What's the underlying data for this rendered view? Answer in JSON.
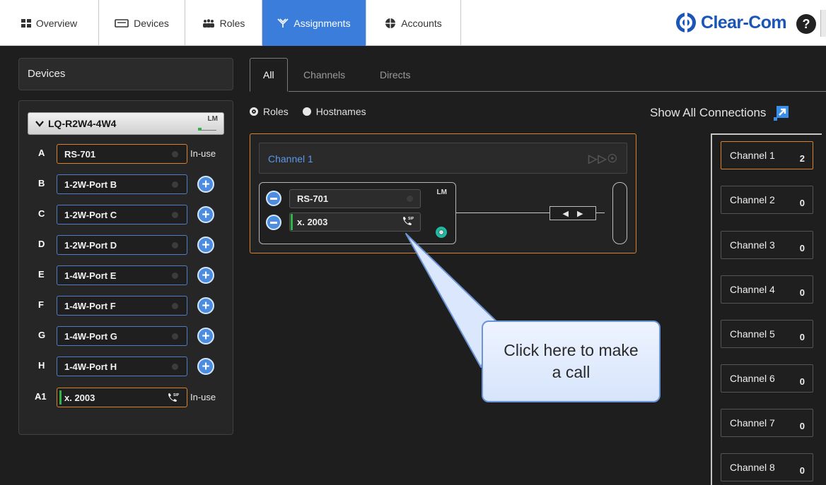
{
  "nav": {
    "tabs": [
      {
        "label": "Overview",
        "icon": "grid-icon"
      },
      {
        "label": "Devices",
        "icon": "device-icon"
      },
      {
        "label": "Roles",
        "icon": "people-icon"
      },
      {
        "label": "Assignments",
        "icon": "assignments-icon",
        "active": true
      },
      {
        "label": "Accounts",
        "icon": "accounts-icon"
      }
    ],
    "brand": "Clear-Com",
    "help_label": "?"
  },
  "devices_panel": {
    "header": "Devices",
    "device": {
      "name": "LQ-R2W4-4W4",
      "meter_label": "LM",
      "ports": [
        {
          "letter": "A",
          "name": "RS-701",
          "status": "In-use"
        },
        {
          "letter": "B",
          "name": "1-2W-Port B"
        },
        {
          "letter": "C",
          "name": "1-2W-Port C"
        },
        {
          "letter": "D",
          "name": "1-2W-Port D"
        },
        {
          "letter": "E",
          "name": "1-4W-Port E"
        },
        {
          "letter": "F",
          "name": "1-4W-Port F"
        },
        {
          "letter": "G",
          "name": "1-4W-Port G"
        },
        {
          "letter": "H",
          "name": "1-4W-Port H"
        },
        {
          "letter": "A1",
          "name": "x. 2003",
          "status": "In-use",
          "sip": true
        }
      ]
    }
  },
  "subtabs": [
    "All",
    "Channels",
    "Directs"
  ],
  "view_mode": {
    "options": [
      "Roles",
      "Hostnames"
    ],
    "selected": "Roles"
  },
  "show_all_connections": "Show All Connections",
  "assignment": {
    "channel_name": "Channel 1",
    "card_lm": "LM",
    "members": [
      "RS-701",
      "x. 2003"
    ]
  },
  "callout": "Click here to make a call",
  "channels": [
    {
      "name": "Channel 1",
      "count": "2"
    },
    {
      "name": "Channel 2",
      "count": "0"
    },
    {
      "name": "Channel 3",
      "count": "0"
    },
    {
      "name": "Channel 4",
      "count": "0"
    },
    {
      "name": "Channel 5",
      "count": "0"
    },
    {
      "name": "Channel 6",
      "count": "0"
    },
    {
      "name": "Channel 7",
      "count": "0"
    },
    {
      "name": "Channel 8",
      "count": "0"
    }
  ],
  "colors": {
    "accent_blue": "#3b7ddb",
    "active_orange": "#d9822b",
    "in_use_green": "#2fb34a"
  }
}
